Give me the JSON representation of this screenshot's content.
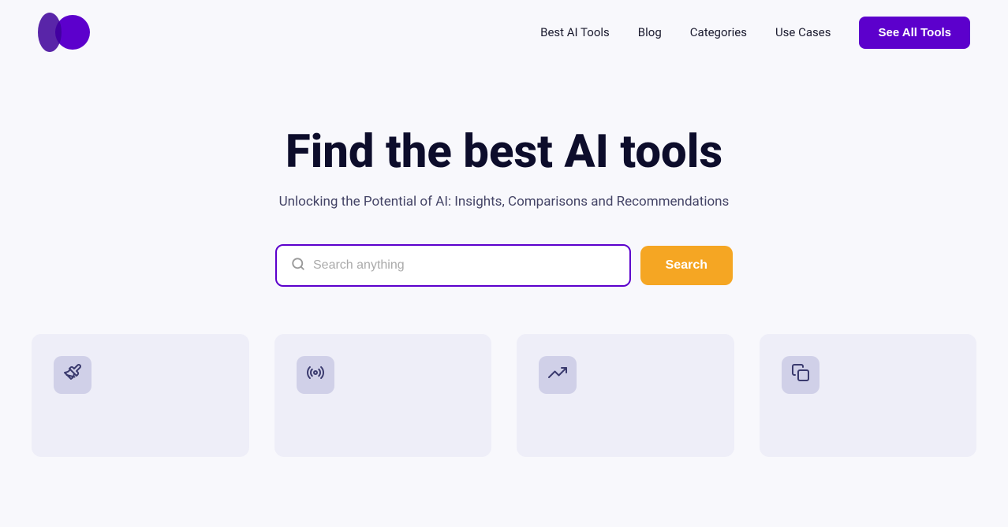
{
  "navbar": {
    "logo_alt": "AI Tools Logo",
    "nav_items": [
      {
        "id": "best-ai-tools",
        "label": "Best AI Tools"
      },
      {
        "id": "blog",
        "label": "Blog"
      },
      {
        "id": "categories",
        "label": "Categories"
      },
      {
        "id": "use-cases",
        "label": "Use Cases"
      }
    ],
    "cta_label": "See All Tools"
  },
  "hero": {
    "title": "Find the best AI tools",
    "subtitle": "Unlocking the Potential of AI: Insights, Comparisons and Recommendations",
    "search": {
      "placeholder": "Search anything",
      "button_label": "Search"
    }
  },
  "cards": [
    {
      "id": "card-1",
      "icon": "✏️"
    },
    {
      "id": "card-2",
      "icon": "📡"
    },
    {
      "id": "card-3",
      "icon": "📈"
    },
    {
      "id": "card-4",
      "icon": "📋"
    }
  ],
  "colors": {
    "accent_purple": "#5c00cc",
    "accent_orange": "#f5a623",
    "dark_navy": "#0d0d2b",
    "card_bg": "#eeeef8",
    "icon_bg": "#d0d0e8",
    "icon_color": "#3a3a6e"
  }
}
